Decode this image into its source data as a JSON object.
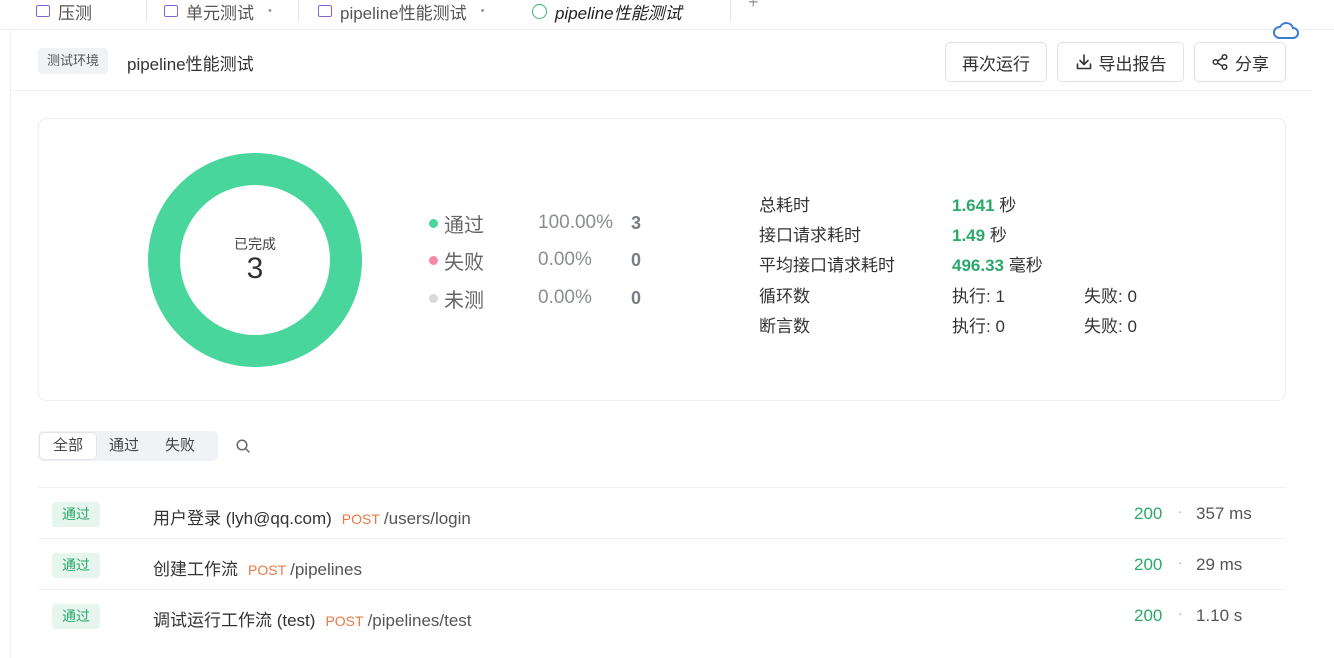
{
  "tabs": [
    {
      "label": "压测"
    },
    {
      "label": "单元测试"
    },
    {
      "label": "pipeline性能测试"
    },
    {
      "label": "pipeline性能测试",
      "active": true
    }
  ],
  "header": {
    "env_badge": "测试环境",
    "title": "pipeline性能测试",
    "rerun_label": "再次运行",
    "export_label": "导出报告",
    "share_label": "分享"
  },
  "summary": {
    "donut_label": "已完成",
    "donut_value": "3",
    "legend": [
      {
        "name": "通过",
        "percent": "100.00%",
        "count": "3",
        "color": "#48d69c"
      },
      {
        "name": "失败",
        "percent": "0.00%",
        "count": "0",
        "color": "#f38aa5"
      },
      {
        "name": "未测",
        "percent": "0.00%",
        "count": "0",
        "color": "#d9d9d9"
      }
    ],
    "stats": {
      "total_time": {
        "label": "总耗时",
        "value": "1.641",
        "unit": "秒"
      },
      "request_time": {
        "label": "接口请求耗时",
        "value": "1.49",
        "unit": "秒"
      },
      "avg_request_time": {
        "label": "平均接口请求耗时",
        "value": "496.33",
        "unit": "毫秒"
      },
      "loops": {
        "label": "循环数",
        "executed": "执行: 1",
        "failed": "失败: 0"
      },
      "assertions": {
        "label": "断言数",
        "executed": "执行: 0",
        "failed": "失败: 0"
      }
    }
  },
  "filters": {
    "all": "全部",
    "passed": "通过",
    "failed": "失败",
    "active": "全部"
  },
  "results": [
    {
      "status": "通过",
      "name": "用户登录 (lyh@qq.com)",
      "method": "POST",
      "path": "/users/login",
      "code": "200",
      "time": "357 ms"
    },
    {
      "status": "通过",
      "name": "创建工作流",
      "method": "POST",
      "path": "/pipelines",
      "code": "200",
      "time": "29 ms"
    },
    {
      "status": "通过",
      "name": "调试运行工作流 (test)",
      "method": "POST",
      "path": "/pipelines/test",
      "code": "200",
      "time": "1.10 s"
    }
  ],
  "separator": "·"
}
